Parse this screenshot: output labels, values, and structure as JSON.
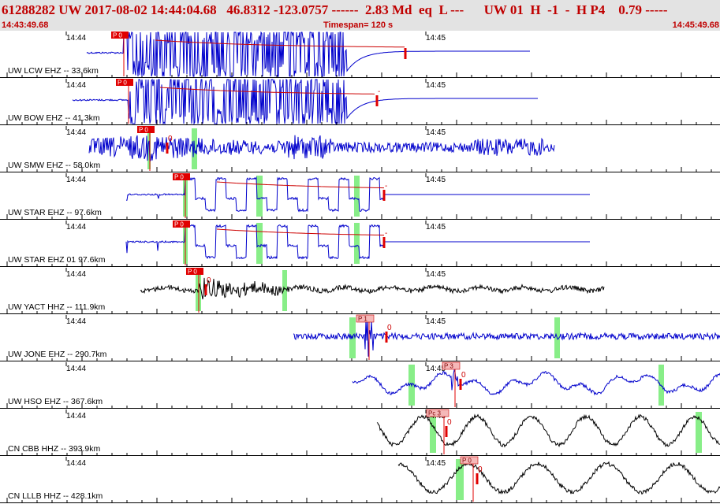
{
  "header": {
    "title": "61288282 UW 2017-08-02 14:44:04.68   46.8312 -123.0757 ------  2.83 Md  eq  L ---      UW 01  H  -1  -  H P4    0.79 -----",
    "start_time": "14:43:49.68",
    "timespan": "Timespan= 120 s",
    "end_time": "14:45:49.68"
  },
  "colors": {
    "header_bg": "#e3e3e3",
    "header_text": "#c00000",
    "blue_trace": "#0000cc",
    "black_trace": "#000000",
    "pick": "#e00000",
    "pick_light": "#f5b8b8",
    "window": "#88ee88"
  },
  "channels": [
    {
      "label": "UW LCW EHZ -- 33.6km",
      "time_a": "14:44",
      "time_b": "14:45",
      "pick": "P 0",
      "coda": "",
      "color": "blue"
    },
    {
      "label": "UW BOW EHZ -- 41.3km",
      "time_a": "14:44",
      "time_b": "14:45",
      "pick": "P 0",
      "coda": "-",
      "color": "blue"
    },
    {
      "label": "UW SMW EHZ -- 58.0km",
      "time_a": "14:44",
      "time_b": "14:45",
      "pick": "P 0",
      "coda": "0",
      "color": "blue"
    },
    {
      "label": "UW STAR EHZ -- 97.6km",
      "time_a": "14:44",
      "time_b": "14:45",
      "pick": "P 0",
      "coda": "-",
      "color": "blue"
    },
    {
      "label": "UW STAR EHZ 01 97.6km",
      "time_a": "14:44",
      "time_b": "14:45",
      "pick": "P 0",
      "coda": "-",
      "color": "blue"
    },
    {
      "label": "UW YACT HHZ -- 111.9km",
      "time_a": "14:44",
      "time_b": "14:45",
      "pick": "P 0",
      "coda": "0",
      "color": "black"
    },
    {
      "label": "UW JONE EHZ -- 290.7km",
      "time_a": "14:44",
      "time_b": "14:45",
      "pick": "P 1",
      "coda": "0",
      "color": "blue"
    },
    {
      "label": "UW HSO EHZ -- 367.6km",
      "time_a": "14:44",
      "time_b": "14:45",
      "pick": "P 3",
      "coda": "0",
      "color": "blue"
    },
    {
      "label": "CN CBB HHZ -- 393.9km",
      "time_a": "14:44",
      "time_b": "14:45",
      "pick": "Pc 3",
      "coda": "0",
      "color": "black"
    },
    {
      "label": "CN LLLB HHZ -- 428.1km",
      "time_a": "14:44",
      "time_b": "14:45",
      "pick": "P 0",
      "coda": "0",
      "color": "black"
    }
  ]
}
